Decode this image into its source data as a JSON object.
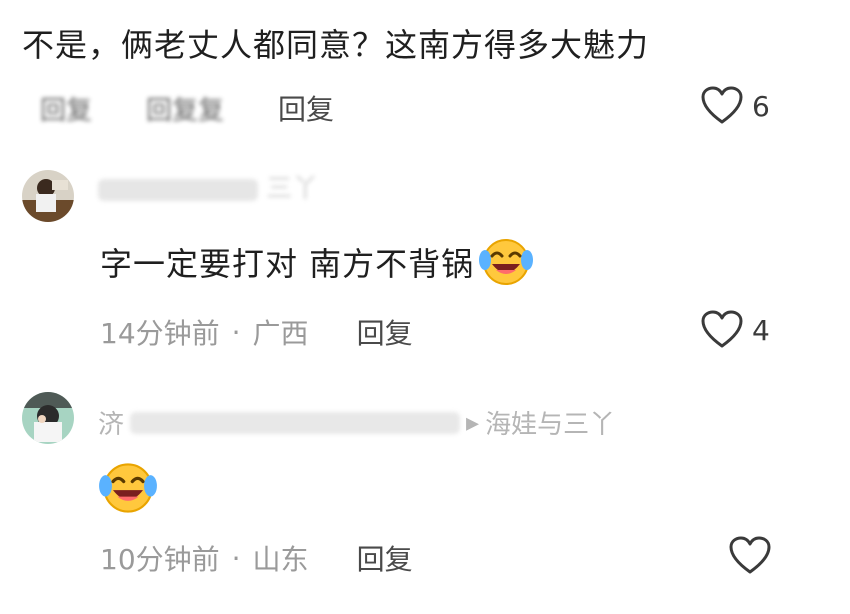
{
  "comments": [
    {
      "text": "不是，俩老丈人都同意？这南方得多大魅力",
      "replies_blurred_1": "回复",
      "replies_blurred_2": "回复复",
      "reply_label": "回复",
      "likes": "6"
    },
    {
      "username_visible": "三丫",
      "text": "字一定要打对 南方不背锅",
      "time": "14分钟前",
      "separator": "·",
      "location": "广西",
      "reply_label": "回复",
      "likes": "4"
    },
    {
      "username_prefix": "济",
      "username_suffix": "海娃与三丫",
      "text": "",
      "time": "10分钟前",
      "separator": "·",
      "location": "山东",
      "reply_label": "回复",
      "likes": ""
    }
  ],
  "icons": {
    "like": "heart-outline-icon",
    "emoji": "laughing-crying-emoji"
  },
  "colors": {
    "primary_text": "#1f1f1f",
    "meta_text": "#9a9a9a",
    "icon": "#3a3a3a"
  }
}
